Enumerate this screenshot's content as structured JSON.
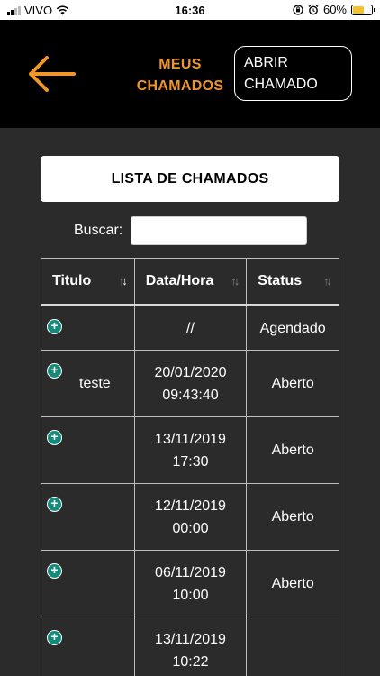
{
  "status_bar": {
    "carrier": "VIVO",
    "time": "16:36",
    "battery_percent": "60%",
    "battery_level": 0.6,
    "icons": [
      "signal-icon",
      "wifi-icon",
      "orientation-lock-icon",
      "alarm-icon",
      "battery-icon"
    ]
  },
  "header": {
    "title_line1": "MEUS",
    "title_line2": "CHAMADOS",
    "open_button_line1": "ABRIR",
    "open_button_line2": "CHAMADO",
    "back_icon": "arrow-left-icon"
  },
  "colors": {
    "accent": "#f0952c",
    "header_bg": "#000000",
    "body_bg": "#2b2b2b",
    "plus_icon": "#148a7a"
  },
  "list": {
    "title": "LISTA DE CHAMADOS",
    "search_label": "Buscar:",
    "search_value": ""
  },
  "table": {
    "columns": [
      "Titulo",
      "Data/Hora",
      "Status"
    ],
    "rows": [
      {
        "titulo": "",
        "data_line1": "//",
        "data_line2": "",
        "status": "Agendado"
      },
      {
        "titulo": "teste",
        "data_line1": "20/01/2020",
        "data_line2": "09:43:40",
        "status": "Aberto"
      },
      {
        "titulo": "",
        "data_line1": "13/11/2019",
        "data_line2": "17:30",
        "status": "Aberto"
      },
      {
        "titulo": "",
        "data_line1": "12/11/2019",
        "data_line2": "00:00",
        "status": "Aberto"
      },
      {
        "titulo": "",
        "data_line1": "06/11/2019",
        "data_line2": "10:00",
        "status": "Aberto"
      },
      {
        "titulo": "",
        "data_line1": "13/11/2019",
        "data_line2": "10:22",
        "status": ""
      }
    ]
  }
}
